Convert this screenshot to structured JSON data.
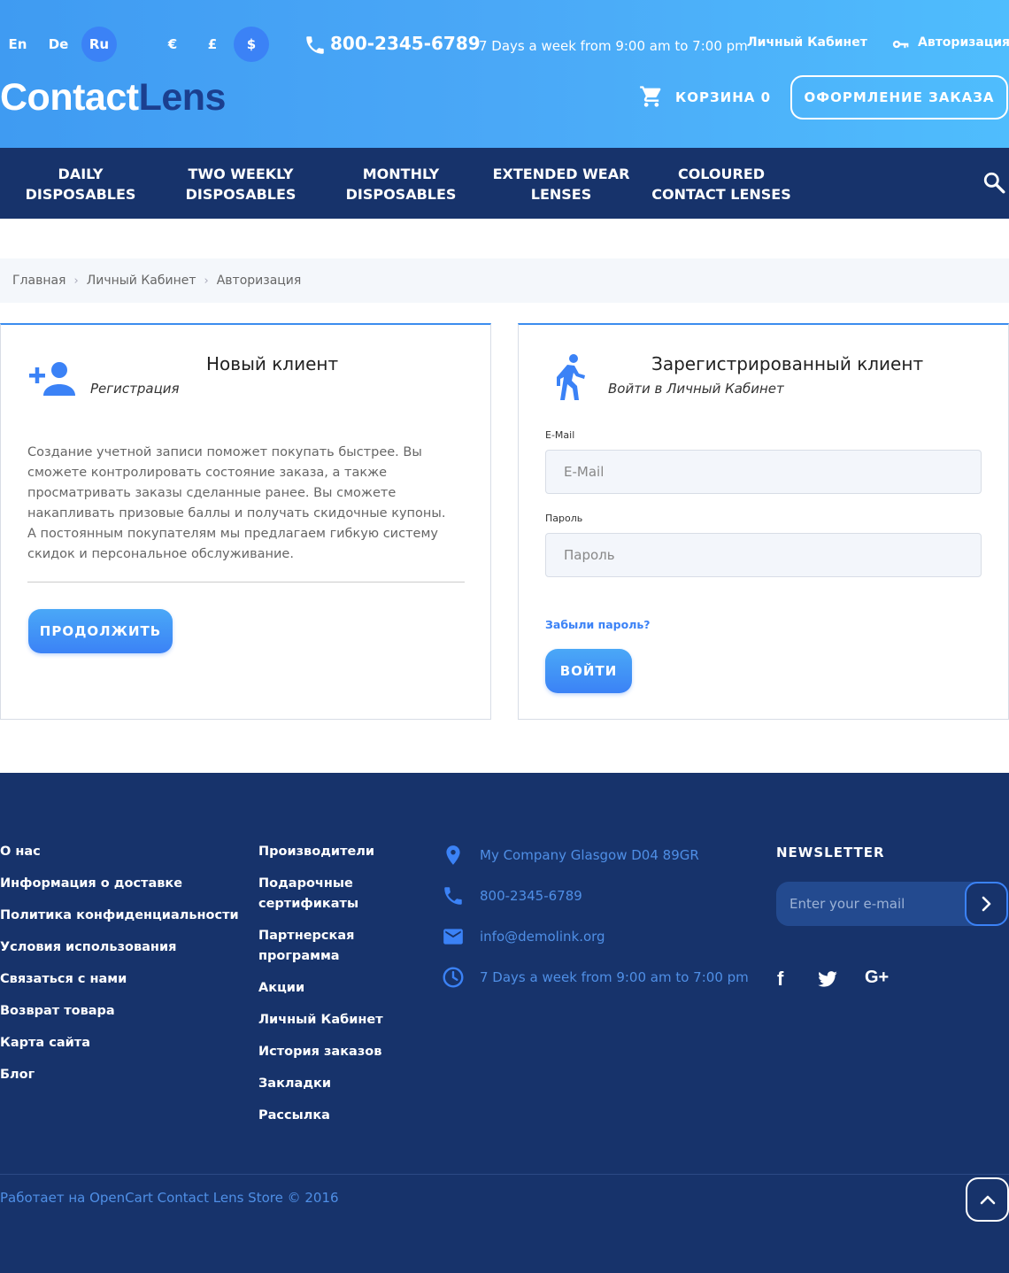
{
  "header": {
    "languages": [
      "En",
      "De",
      "Ru"
    ],
    "active_language": "Ru",
    "currencies": [
      "€",
      "£",
      "$"
    ],
    "active_currency": "$",
    "phone": "800-2345-6789",
    "hours": "7 Days a week from 9:00 am to 7:00 pm",
    "account_link": "Личный Кабинет",
    "login_link": "Авторизация",
    "logo_part1": "Contact",
    "logo_part2": "Lens",
    "cart_label": "КОРЗИНА 0",
    "checkout_label": "ОФОРМЛЕНИЕ ЗАКАЗА",
    "colors": {
      "gradient_start": "#3f9bf2",
      "gradient_end": "#4fbdfd",
      "logo_dark": "#1b3f8f"
    }
  },
  "nav": {
    "items": [
      {
        "line1": "DAILY",
        "line2": "DISPOSABLES"
      },
      {
        "line1": "TWO WEEKLY",
        "line2": "DISPOSABLES"
      },
      {
        "line1": "MONTHLY",
        "line2": "DISPOSABLES"
      },
      {
        "line1": "EXTENDED WEAR",
        "line2": "LENSES"
      },
      {
        "line1": "COLOURED",
        "line2": "CONTACT LENSES"
      }
    ],
    "bg_color": "#17336b"
  },
  "breadcrumb": [
    "Главная",
    "Личный Кабинет",
    "Авторизация"
  ],
  "new_client": {
    "title": "Новый клиент",
    "subtitle": "Регистрация",
    "description": "Создание учетной записи поможет покупать быстрее. Вы сможете контролировать состояние заказа, а также просматривать заказы сделанные ранее. Вы сможете накапливать призовые баллы и получать скидочные купоны. А постоянным покупателям мы предлагаем гибкую систему скидок и персональное обслуживание.",
    "button": "ПРОДОЛЖИТЬ"
  },
  "returning_client": {
    "title": "Зарегистрированный клиент",
    "subtitle": "Войти в Личный Кабинет",
    "email_label": "E-Mail",
    "email_placeholder": "E-Mail",
    "password_label": "Пароль",
    "password_placeholder": "Пароль",
    "forgot": "Забыли пароль?",
    "button": "ВОЙТИ"
  },
  "footer": {
    "col1": [
      "О нас",
      "Информация о доставке",
      "Политика конфиденциальности",
      "Условия использования",
      "Связаться с нами",
      "Возврат товара",
      "Карта сайта",
      "Блог"
    ],
    "col2": [
      "Производители",
      "Подарочные сертификаты",
      "Партнерская программа",
      "Акции",
      "Личный Кабинет",
      "История заказов",
      "Закладки",
      "Рассылка"
    ],
    "contacts": {
      "address": "My Company Glasgow D04 89GR",
      "phone": "800-2345-6789",
      "email": "info@demolink.org",
      "hours": "7 Days a week from 9:00 am to 7:00 pm"
    },
    "newsletter_title": "NEWSLETTER",
    "newsletter_placeholder": "Enter your e-mail",
    "social": [
      "facebook-icon",
      "twitter-icon",
      "google-plus-icon"
    ],
    "social_gplus_text": "G+",
    "social_fb_text": "f",
    "copyright": "Работает на OpenCart Contact Lens Store © 2016"
  }
}
